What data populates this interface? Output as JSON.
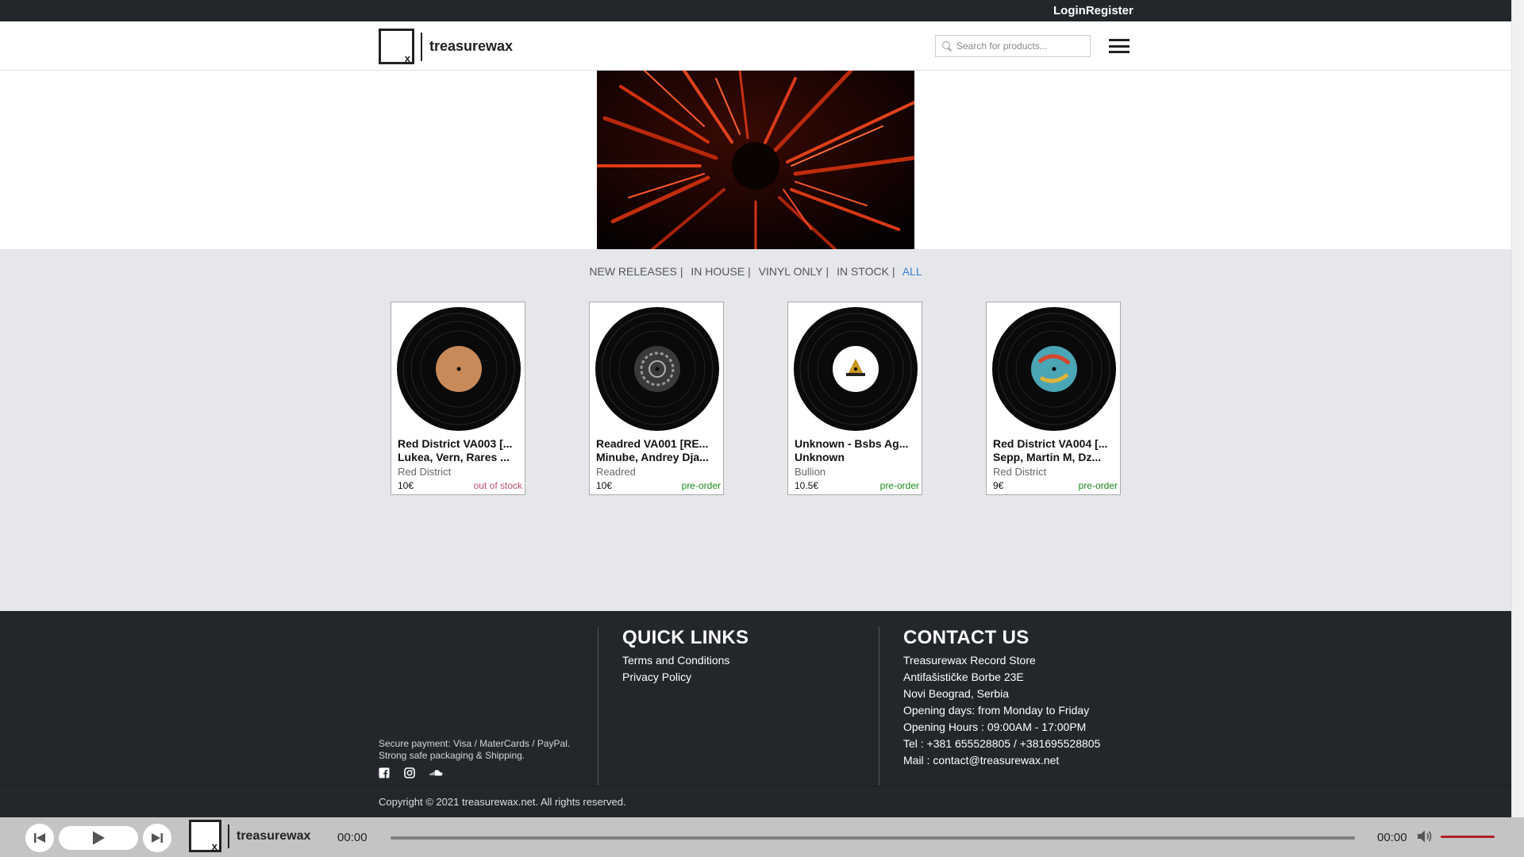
{
  "topbar": {
    "login": "Login",
    "register": "Register"
  },
  "header": {
    "logo_text": "treasurewax",
    "search_placeholder": "Search for products...",
    "menu_icon": "hamburger-icon"
  },
  "filters": [
    {
      "label": "NEW RELEASES",
      "sep": "|",
      "active": false
    },
    {
      "label": "IN HOUSE",
      "sep": "|",
      "active": false
    },
    {
      "label": "VINYL ONLY",
      "sep": "|",
      "active": false
    },
    {
      "label": "IN STOCK",
      "sep": "|",
      "active": false
    },
    {
      "label": "ALL",
      "sep": "",
      "active": true
    }
  ],
  "products": [
    {
      "title": "Red District VA003 [...",
      "artist": "Lukea, Vern, Rares ...",
      "label": "Red District",
      "price": "10€",
      "status": "out of stock",
      "status_type": "out",
      "label_color": "#c98a5a"
    },
    {
      "title": "Readred VA001 [RE...",
      "artist": "Minube, Andrey Dja...",
      "label": "Readred",
      "price": "10€",
      "status": "pre-order",
      "status_type": "pre",
      "label_color": "#3a3a3a"
    },
    {
      "title": "Unknown - Bsbs Ag...",
      "artist": "Unknown",
      "label": "Bullion",
      "price": "10.5€",
      "status": "pre-order",
      "status_type": "pre",
      "label_color": "#ffffff"
    },
    {
      "title": "Red District VA004 [...",
      "artist": "Sepp, Martin M, Dz...",
      "label": "Red District",
      "price": "9€",
      "status": "pre-order",
      "status_type": "pre",
      "label_color": "#4aa5b5"
    }
  ],
  "footer": {
    "payment_line1": "Secure payment: Visa / MaterCards / PayPal.",
    "payment_line2": "Strong safe packaging & Shipping.",
    "social_icons": [
      "facebook-icon",
      "instagram-icon",
      "soundcloud-icon"
    ],
    "quick_links_title": "QUICK LINKS",
    "quick_links": [
      "Terms and Conditions",
      "Privacy Policy"
    ],
    "contact_title": "CONTACT US",
    "contact_lines": [
      "Treasurewax Record Store",
      "Antifašističke Borbe 23E",
      "Novi Beograd, Serbia",
      "Opening days: from Monday to Friday",
      "Opening Hours : 09:00AM - 17:00PM",
      "Tel : +381 655528805 / +381695528805",
      "Mail : contact@treasurewax.net"
    ],
    "copyright": "Copyright © 2021 treasurewax.net. All rights reserved."
  },
  "player": {
    "logo_text": "treasurewax",
    "current_time": "00:00",
    "duration": "00:00",
    "progress": 0,
    "volume": 1.0,
    "volume_color": "#b22028"
  }
}
